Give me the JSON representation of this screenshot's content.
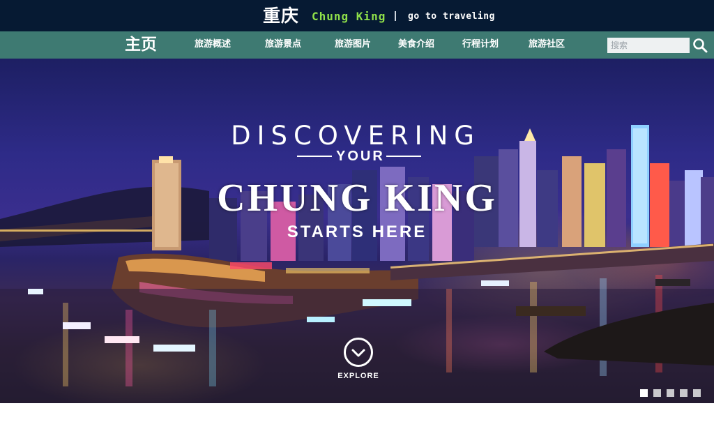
{
  "header": {
    "brand_cn": "重庆",
    "brand_en": "Chung King",
    "tagline": "go to traveling"
  },
  "nav": {
    "home": "主页",
    "items": [
      {
        "label": "旅游概述"
      },
      {
        "label": "旅游景点"
      },
      {
        "label": "旅游图片"
      },
      {
        "label": "美食介绍"
      },
      {
        "label": "行程计划"
      },
      {
        "label": "旅游社区"
      }
    ],
    "search": {
      "placeholder": "搜索",
      "icon": "search-icon"
    }
  },
  "hero": {
    "line1": "DISCOVERING",
    "line2": "YOUR",
    "line3": "CHUNG KING",
    "line4": "STARTS HERE",
    "explore": "EXPLORE",
    "explore_icon": "chevron-down-icon",
    "slides_total": 5,
    "active_slide": 1
  },
  "colors": {
    "topbar": "#061a33",
    "navbar": "#3e7a72",
    "brand_en": "#8fe04a"
  }
}
